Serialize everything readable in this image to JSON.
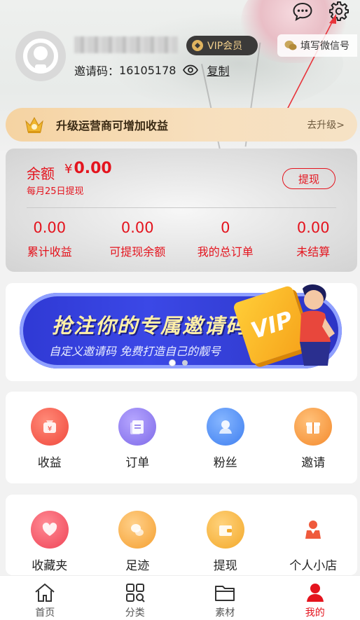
{
  "colors": {
    "accent": "#e4141e",
    "vip_gold": "#f1cf8c",
    "promo_blue": "#3b48e6"
  },
  "header": {
    "icons": [
      "chat-icon",
      "gear-icon"
    ],
    "vip_label": "VIP会员",
    "wechat_label": "填写微信号",
    "invite_label": "邀请码：",
    "invite_code": "16105178",
    "copy_label": "复制"
  },
  "upgrade": {
    "text": "升级运营商可增加收益",
    "action": "去升级>"
  },
  "balance": {
    "label": "余额",
    "currency": "¥",
    "amount": "0.00",
    "note": "每月25日提现",
    "withdraw_label": "提现",
    "stats": [
      {
        "value": "0.00",
        "label": "累计收益"
      },
      {
        "value": "0.00",
        "label": "可提现余额"
      },
      {
        "value": "0",
        "label": "我的总订单"
      },
      {
        "value": "0.00",
        "label": "未结算"
      }
    ]
  },
  "promo": {
    "title": "抢注你的专属邀请码",
    "subtitle": "自定义邀请码  免费打造自己的靓号",
    "badge": "VIP",
    "slides": 2,
    "active_slide": 1
  },
  "grid1": [
    {
      "label": "收益",
      "icon": "income-icon",
      "color": "#f2574b"
    },
    {
      "label": "订单",
      "icon": "order-icon",
      "color": "#8f7cf0"
    },
    {
      "label": "粉丝",
      "icon": "fans-icon",
      "color": "#4a8ef2"
    },
    {
      "label": "邀请",
      "icon": "invite-gift-icon",
      "color": "#f79a3c"
    }
  ],
  "grid2": [
    {
      "label": "收藏夹",
      "icon": "heart-icon",
      "color": "#f25a67"
    },
    {
      "label": "足迹",
      "icon": "footprint-icon",
      "color": "#f7a540"
    },
    {
      "label": "提现",
      "icon": "wallet-icon",
      "color": "#f7b13c"
    },
    {
      "label": "个人小店",
      "icon": "shop-person-icon",
      "color": "#ef5a3c"
    }
  ],
  "tabs": [
    {
      "label": "首页",
      "icon": "home-icon"
    },
    {
      "label": "分类",
      "icon": "category-icon"
    },
    {
      "label": "素材",
      "icon": "folder-icon"
    },
    {
      "label": "我的",
      "icon": "user-icon",
      "active": true
    }
  ]
}
